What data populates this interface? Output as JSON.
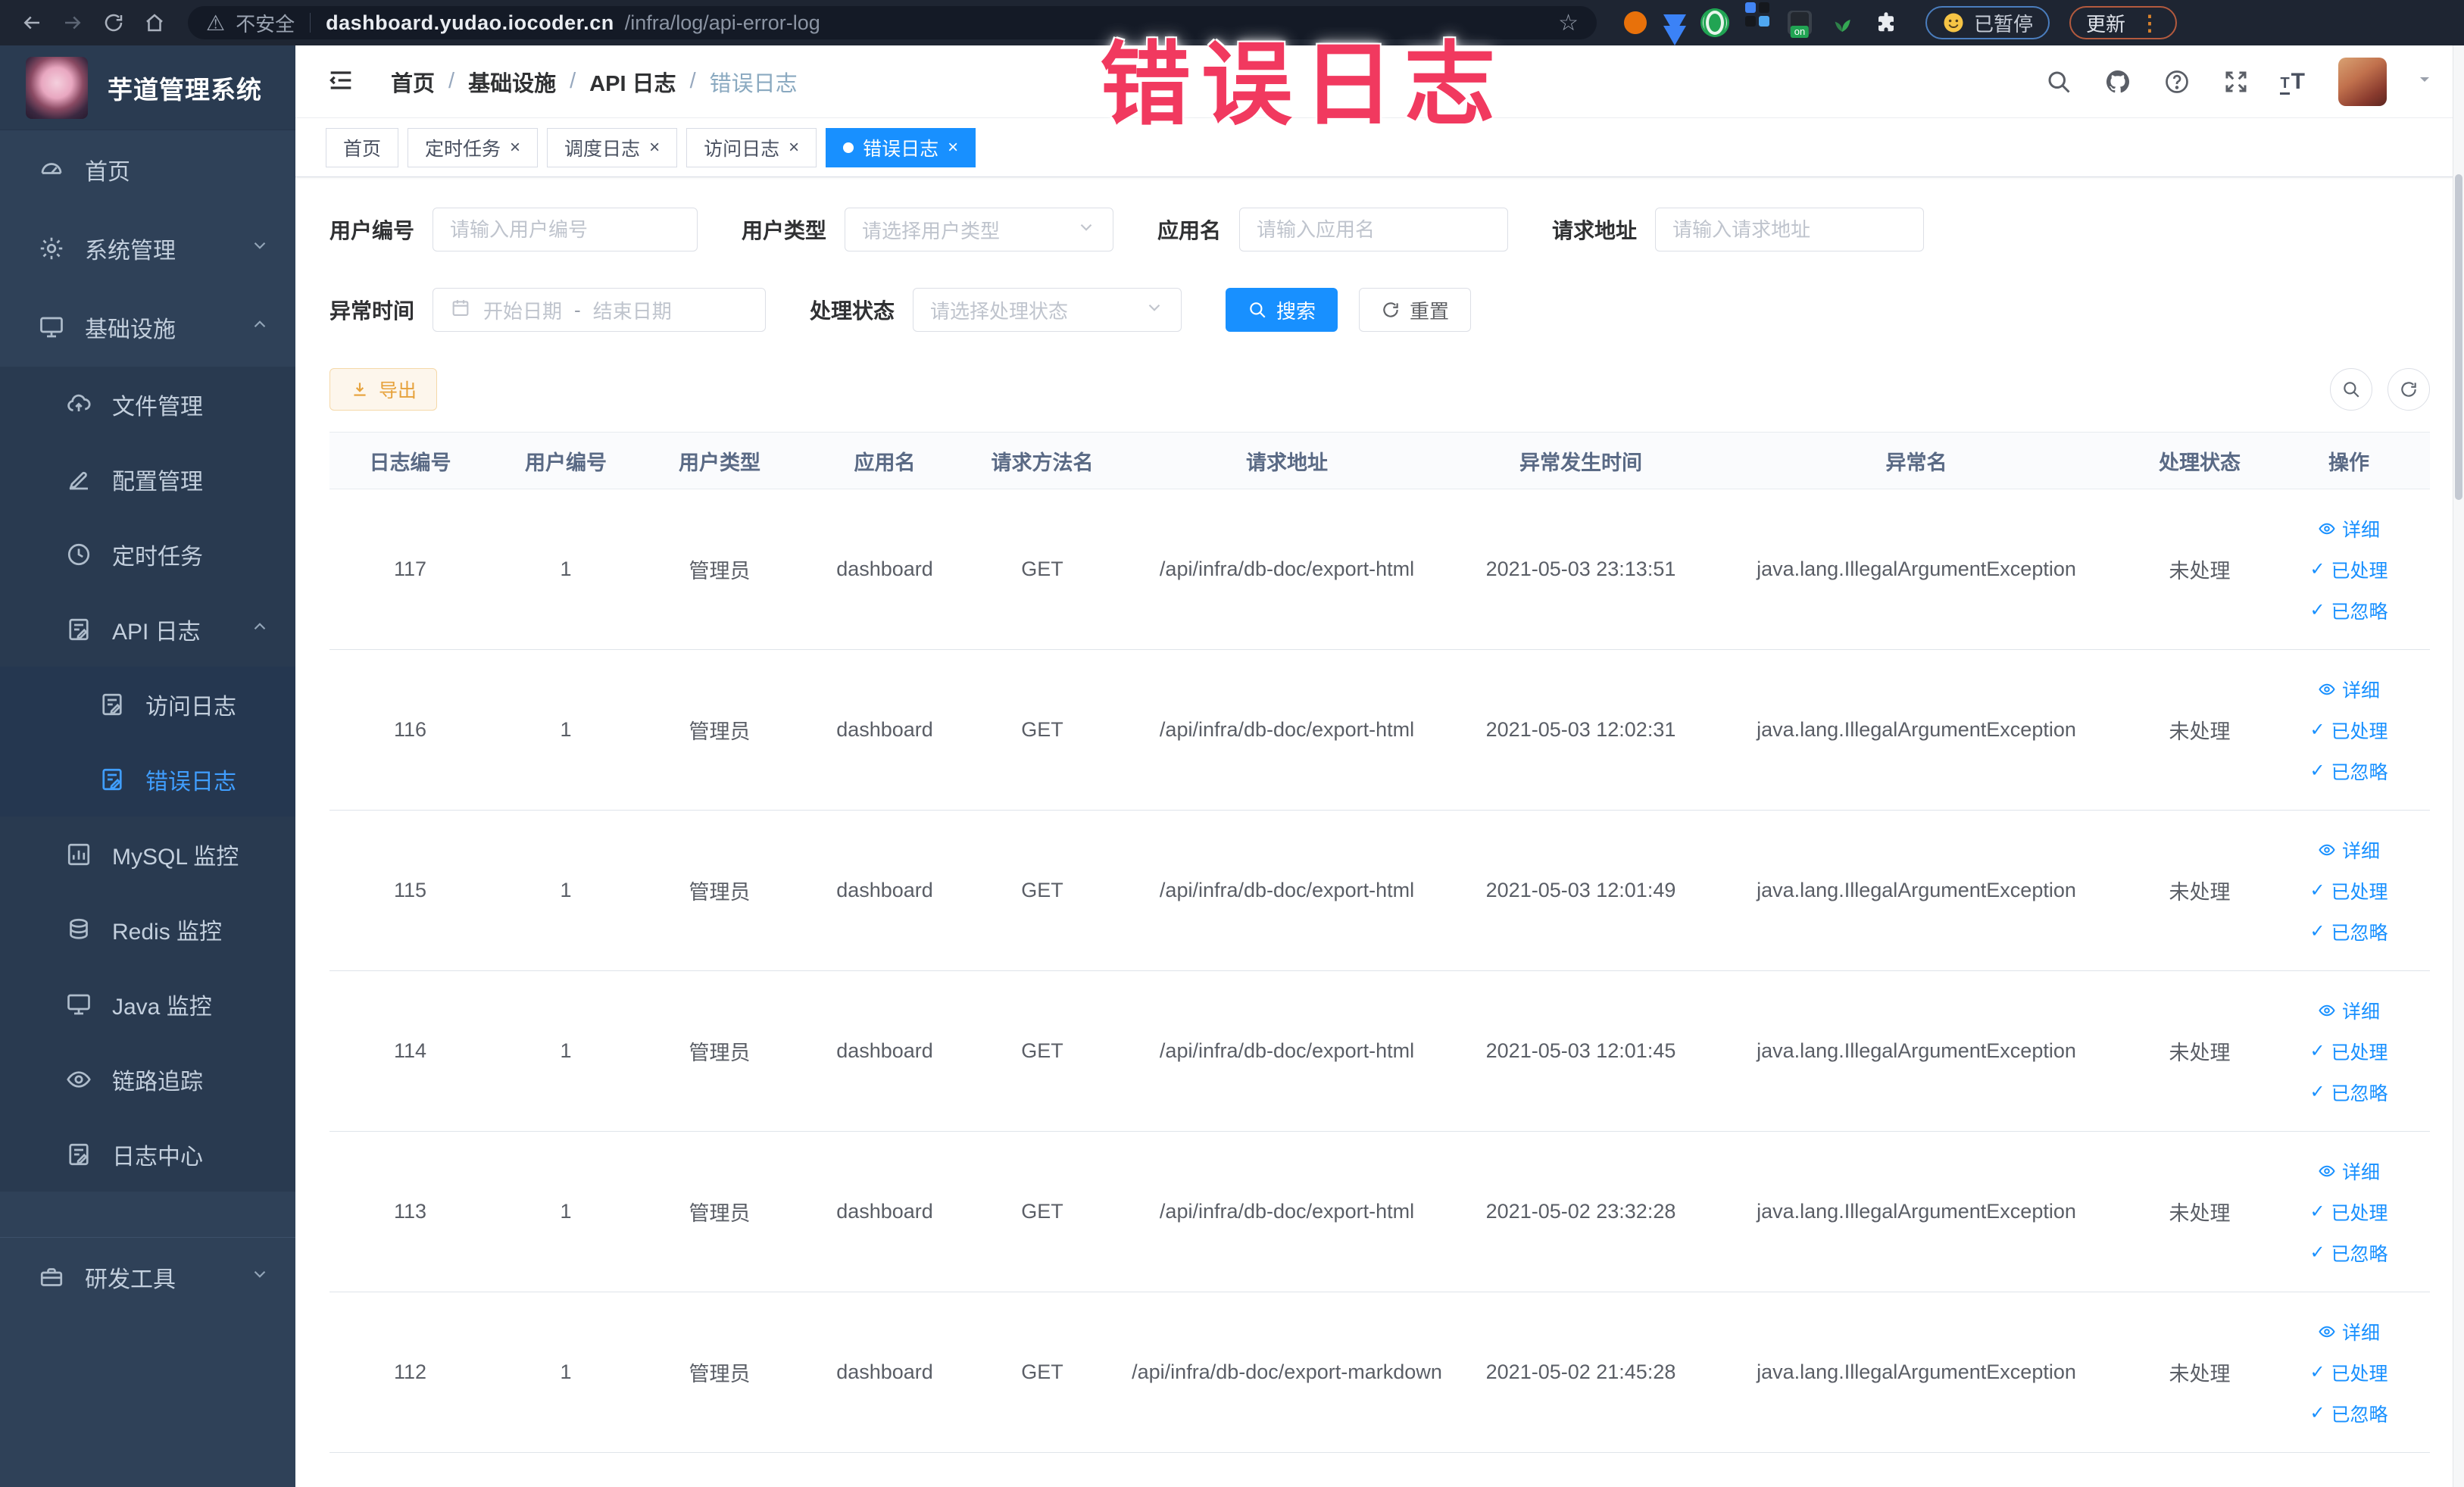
{
  "browser": {
    "security_label": "不安全",
    "url_domain": "dashboard.yudao.iocoder.cn",
    "url_path": "/infra/log/api-error-log",
    "paused_badge": "已暂停",
    "update_button": "更新",
    "extensions": [
      {
        "name": "extension-orange-donut-icon",
        "type": "donut"
      },
      {
        "name": "extension-blue-shield-icon",
        "type": "shield"
      },
      {
        "name": "extension-green-ring-icon",
        "type": "ring"
      },
      {
        "name": "extension-grid-icon",
        "type": "grid"
      },
      {
        "name": "extension-dark-on-icon",
        "type": "darkon",
        "badge": "on"
      },
      {
        "name": "extension-leaf-icon",
        "type": "leaf"
      },
      {
        "name": "extensions-puzzle-icon",
        "type": "puzzle"
      }
    ]
  },
  "overlay": {
    "text": "错误日志"
  },
  "sidebar": {
    "logo_title": "芋道管理系统",
    "items": [
      {
        "label": "首页",
        "icon": "home",
        "level": 0
      },
      {
        "label": "系统管理",
        "icon": "gear",
        "level": 0,
        "chevron": "down"
      },
      {
        "label": "基础设施",
        "icon": "monitor",
        "level": 0,
        "chevron": "up"
      },
      {
        "label": "文件管理",
        "icon": "cloud",
        "level": 1
      },
      {
        "label": "配置管理",
        "icon": "edit",
        "level": 1
      },
      {
        "label": "定时任务",
        "icon": "clock",
        "level": 1
      },
      {
        "label": "API 日志",
        "icon": "log",
        "level": 1,
        "chevron": "up"
      },
      {
        "label": "访问日志",
        "icon": "log",
        "level": 2
      },
      {
        "label": "错误日志",
        "icon": "log",
        "level": 2,
        "active": true
      },
      {
        "label": "MySQL 监控",
        "icon": "chart",
        "level": 1
      },
      {
        "label": "Redis 监控",
        "icon": "layers",
        "level": 1
      },
      {
        "label": "Java 监控",
        "icon": "monitor",
        "level": 1
      },
      {
        "label": "链路追踪",
        "icon": "eye",
        "level": 1
      },
      {
        "label": "日志中心",
        "icon": "log",
        "level": 1
      },
      {
        "label": "研发工具",
        "icon": "toolbox",
        "level": 0,
        "chevron": "down",
        "section": true
      }
    ]
  },
  "header": {
    "breadcrumb": [
      "首页",
      "基础设施",
      "API 日志",
      "错误日志"
    ]
  },
  "tabs": [
    {
      "label": "首页",
      "closable": false,
      "active": false
    },
    {
      "label": "定时任务",
      "closable": true,
      "active": false
    },
    {
      "label": "调度日志",
      "closable": true,
      "active": false
    },
    {
      "label": "访问日志",
      "closable": true,
      "active": false
    },
    {
      "label": "错误日志",
      "closable": true,
      "active": true
    }
  ],
  "filters": {
    "user_id": {
      "label": "用户编号",
      "placeholder": "请输入用户编号"
    },
    "user_type": {
      "label": "用户类型",
      "placeholder": "请选择用户类型"
    },
    "app_name": {
      "label": "应用名",
      "placeholder": "请输入应用名"
    },
    "request_url": {
      "label": "请求地址",
      "placeholder": "请输入请求地址"
    },
    "exception_time": {
      "label": "异常时间",
      "start_placeholder": "开始日期",
      "separator": "-",
      "end_placeholder": "结束日期"
    },
    "process_status": {
      "label": "处理状态",
      "placeholder": "请选择处理状态"
    },
    "search_button": "搜索",
    "reset_button": "重置"
  },
  "toolbar": {
    "export_button": "导出"
  },
  "table": {
    "columns": [
      "日志编号",
      "用户编号",
      "用户类型",
      "应用名",
      "请求方法名",
      "请求地址",
      "异常发生时间",
      "异常名",
      "处理状态",
      "操作"
    ],
    "row_actions": [
      "详细",
      "已处理",
      "已忽略"
    ],
    "rows": [
      [
        "117",
        "1",
        "管理员",
        "dashboard",
        "GET",
        "/api/infra/db-doc/export-html",
        "2021-05-03 23:13:51",
        "java.lang.IllegalArgumentException",
        "未处理"
      ],
      [
        "116",
        "1",
        "管理员",
        "dashboard",
        "GET",
        "/api/infra/db-doc/export-html",
        "2021-05-03 12:02:31",
        "java.lang.IllegalArgumentException",
        "未处理"
      ],
      [
        "115",
        "1",
        "管理员",
        "dashboard",
        "GET",
        "/api/infra/db-doc/export-html",
        "2021-05-03 12:01:49",
        "java.lang.IllegalArgumentException",
        "未处理"
      ],
      [
        "114",
        "1",
        "管理员",
        "dashboard",
        "GET",
        "/api/infra/db-doc/export-html",
        "2021-05-03 12:01:45",
        "java.lang.IllegalArgumentException",
        "未处理"
      ],
      [
        "113",
        "1",
        "管理员",
        "dashboard",
        "GET",
        "/api/infra/db-doc/export-html",
        "2021-05-02 23:32:28",
        "java.lang.IllegalArgumentException",
        "未处理"
      ],
      [
        "112",
        "1",
        "管理员",
        "dashboard",
        "GET",
        "/api/infra/db-doc/export-markdown",
        "2021-05-02 21:45:28",
        "java.lang.IllegalArgumentException",
        "未处理"
      ]
    ]
  },
  "colors": {
    "accent": "#1890ff",
    "sidebar_active": "#409eff",
    "warning": "#e6a23c",
    "overlay_red": "#f1395f"
  }
}
